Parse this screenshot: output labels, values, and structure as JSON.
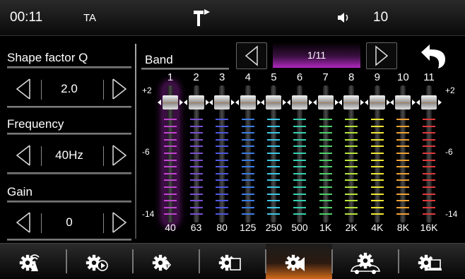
{
  "status": {
    "time": "00:11",
    "ta": "TA",
    "volume": "10"
  },
  "left_panel": {
    "shape_factor_label": "Shape factor Q",
    "shape_factor_value": "2.0",
    "frequency_label": "Frequency",
    "frequency_value": "40Hz",
    "gain_label": "Gain",
    "gain_value": "0"
  },
  "band": {
    "label": "Band",
    "page": "1/11"
  },
  "eq": {
    "axis_top": "+2",
    "axis_mid": "-6",
    "axis_bottom": "-14",
    "gain_range": [
      -14,
      2
    ],
    "selected_band": 1,
    "bands": [
      {
        "num": "1",
        "freq": "40",
        "gain": 0,
        "color": "#c046d0"
      },
      {
        "num": "2",
        "freq": "63",
        "gain": 0,
        "color": "#7a4fd2"
      },
      {
        "num": "3",
        "freq": "80",
        "gain": 0,
        "color": "#4f58e0"
      },
      {
        "num": "4",
        "freq": "125",
        "gain": 0,
        "color": "#3b7fe6"
      },
      {
        "num": "5",
        "freq": "250",
        "gain": 0,
        "color": "#3cc8e6"
      },
      {
        "num": "6",
        "freq": "500",
        "gain": 0,
        "color": "#36d2b0"
      },
      {
        "num": "7",
        "freq": "1K",
        "gain": 0,
        "color": "#4ed26a"
      },
      {
        "num": "8",
        "freq": "2K",
        "gain": 0,
        "color": "#b6e43a"
      },
      {
        "num": "9",
        "freq": "4K",
        "gain": 0,
        "color": "#f0e832"
      },
      {
        "num": "10",
        "freq": "8K",
        "gain": 0,
        "color": "#f0a232"
      },
      {
        "num": "11",
        "freq": "16K",
        "gain": 0,
        "color": "#e23a3a"
      }
    ]
  },
  "tabs": [
    {
      "name": "antenna-settings-icon",
      "active": false
    },
    {
      "name": "media-settings-icon",
      "active": false
    },
    {
      "name": "bluetooth-settings-icon",
      "active": false
    },
    {
      "name": "display-settings-icon",
      "active": false
    },
    {
      "name": "audio-settings-icon",
      "active": true
    },
    {
      "name": "vehicle-settings-icon",
      "active": false
    },
    {
      "name": "system-settings-icon",
      "active": false
    }
  ],
  "colors": {
    "accent": "#d06a1a",
    "selected": "#a020b0"
  }
}
